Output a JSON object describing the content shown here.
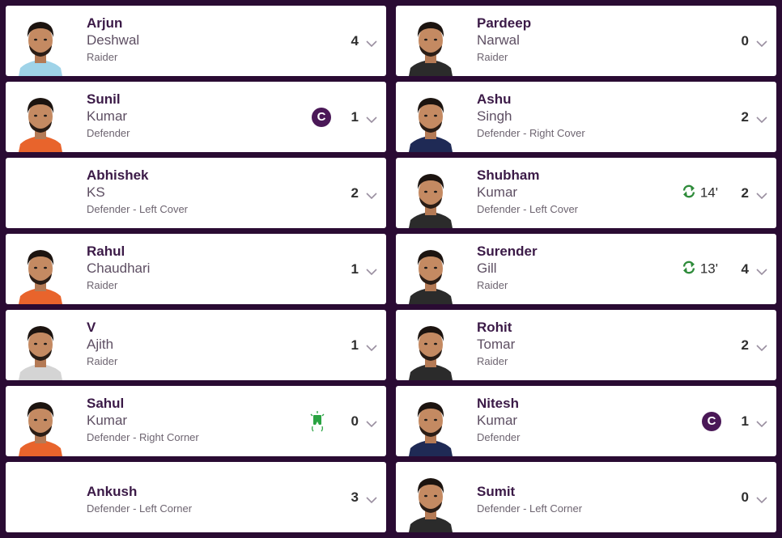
{
  "colors": {
    "background": "#2a0b33",
    "captain": "#4a1857",
    "substitution": "#2e8b3a",
    "green_card": "#2aa342"
  },
  "left": [
    {
      "first": "Arjun",
      "last": "Deshwal",
      "role": "Raider",
      "score": "4",
      "photo": true
    },
    {
      "first": "Sunil",
      "last": "Kumar",
      "role": "Defender",
      "score": "1",
      "photo": true,
      "captain": "C"
    },
    {
      "first": "Abhishek",
      "last": "KS",
      "role": "Defender - Left Cover",
      "score": "2",
      "photo": false
    },
    {
      "first": "Rahul",
      "last": "Chaudhari",
      "role": "Raider",
      "score": "1",
      "photo": true
    },
    {
      "first": "V",
      "last": "Ajith",
      "role": "Raider",
      "score": "1",
      "photo": true
    },
    {
      "first": "Sahul",
      "last": "Kumar",
      "role": "Defender - Right Corner",
      "score": "0",
      "photo": true,
      "card_icon": "green-card-icon"
    },
    {
      "first": "Ankush",
      "last": "",
      "role": "Defender - Left Corner",
      "score": "3",
      "photo": false
    }
  ],
  "right": [
    {
      "first": "Pardeep",
      "last": "Narwal",
      "role": "Raider",
      "score": "0",
      "photo": true
    },
    {
      "first": "Ashu",
      "last": "Singh",
      "role": "Defender - Right Cover",
      "score": "2",
      "photo": true
    },
    {
      "first": "Shubham",
      "last": "Kumar",
      "role": "Defender - Left Cover",
      "score": "2",
      "photo": true,
      "sub_time": "14'"
    },
    {
      "first": "Surender",
      "last": "Gill",
      "role": "Raider",
      "score": "4",
      "photo": true,
      "sub_time": "13'"
    },
    {
      "first": "Rohit",
      "last": "Tomar",
      "role": "Raider",
      "score": "2",
      "photo": true
    },
    {
      "first": "Nitesh",
      "last": "Kumar",
      "role": "Defender",
      "score": "1",
      "photo": true,
      "captain": "C"
    },
    {
      "first": "Sumit",
      "last": "",
      "role": "Defender - Left Corner",
      "score": "0",
      "photo": true
    }
  ]
}
